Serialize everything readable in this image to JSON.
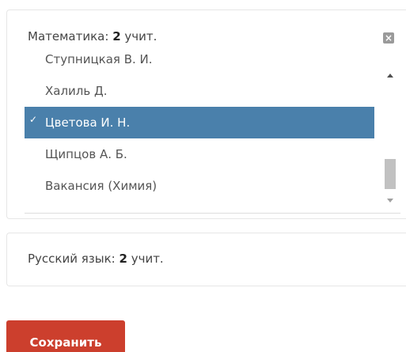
{
  "panels": [
    {
      "subject": "Математика:",
      "count": "2",
      "unit": "учит.",
      "close_symbol": "×",
      "items": [
        {
          "label": "Ступницкая В. И.",
          "selected": false
        },
        {
          "label": "Халиль Д.",
          "selected": false
        },
        {
          "label": "Цветова И. Н.",
          "selected": true,
          "check": "✓"
        },
        {
          "label": "Щипцов А. Б.",
          "selected": false
        },
        {
          "label": "Вакансия (Химия)",
          "selected": false
        }
      ]
    },
    {
      "subject": "Русский язык:",
      "count": "2",
      "unit": "учит."
    }
  ],
  "save_label": "Сохранить",
  "colors": {
    "selected_bg": "#4a80ab",
    "save_bg": "#cc3f2d",
    "close_bg": "#9a9a9a"
  }
}
